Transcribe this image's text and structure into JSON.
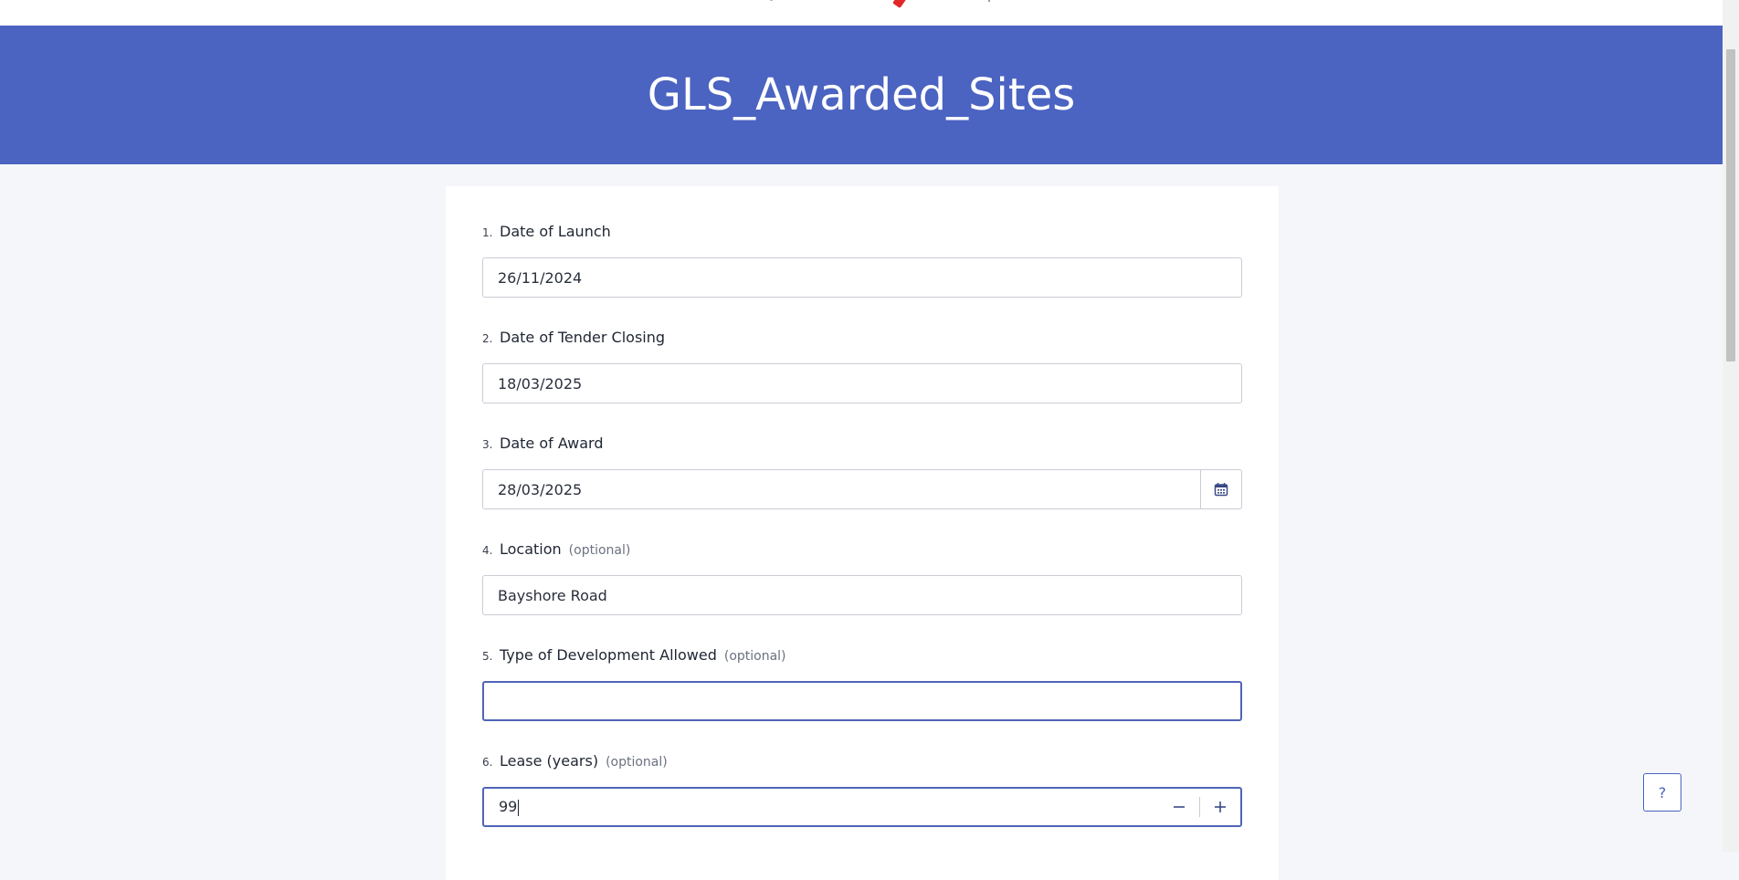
{
  "page": {
    "title": "GLS_Awarded_Sites",
    "help_label": "?"
  },
  "colors": {
    "header_bg": "#4b63c1",
    "accent": "#4b63c1",
    "logo_red": "#e3262a",
    "page_bg": "#f5f6fa"
  },
  "form": {
    "questions": [
      {
        "number": "1.",
        "label": "Date of Launch",
        "optional": "",
        "value": "26/11/2024",
        "type": "date"
      },
      {
        "number": "2.",
        "label": "Date of Tender Closing",
        "optional": "",
        "value": "18/03/2025",
        "type": "date"
      },
      {
        "number": "3.",
        "label": "Date of Award",
        "optional": "",
        "value": "28/03/2025",
        "type": "date-with-picker",
        "icon": "calendar-icon"
      },
      {
        "number": "4.",
        "label": "Location",
        "optional": "(optional)",
        "value": "Bayshore Road",
        "type": "text"
      },
      {
        "number": "5.",
        "label": "Type of Development Allowed",
        "optional": "(optional)",
        "value": "",
        "type": "text",
        "focused": true
      },
      {
        "number": "6.",
        "label": "Lease (years)",
        "optional": "(optional)",
        "value": "99",
        "type": "number",
        "decrement_icon": "minus-icon",
        "increment_icon": "plus-icon"
      }
    ]
  }
}
